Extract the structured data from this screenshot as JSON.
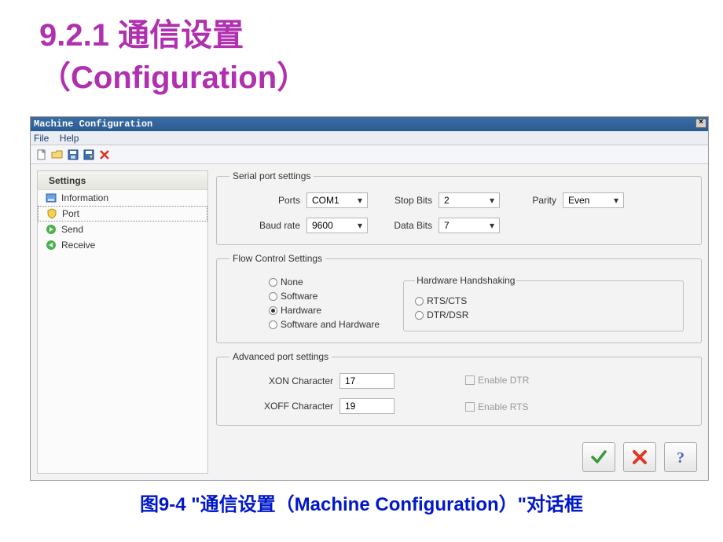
{
  "slide": {
    "title_line1": "9.2.1  通信设置",
    "title_line2": "（Configuration）",
    "caption": "图9-4  \"通信设置（Machine Configuration）\"对话框"
  },
  "window": {
    "title": "Machine Configuration",
    "menu": {
      "file": "File",
      "help": "Help"
    }
  },
  "sidebar": {
    "header": "Settings",
    "items": [
      {
        "label": "Information",
        "icon": "disk"
      },
      {
        "label": "Port",
        "icon": "shield",
        "selected": true
      },
      {
        "label": "Send",
        "icon": "arrow-green"
      },
      {
        "label": "Receive",
        "icon": "arrow-green"
      }
    ]
  },
  "serial": {
    "legend": "Serial port settings",
    "ports_label": "Ports",
    "ports_value": "COM1",
    "stopbits_label": "Stop Bits",
    "stopbits_value": "2",
    "parity_label": "Parity",
    "parity_value": "Even",
    "baud_label": "Baud rate",
    "baud_value": "9600",
    "databits_label": "Data Bits",
    "databits_value": "7"
  },
  "flow": {
    "legend": "Flow Control Settings",
    "options": [
      {
        "label": "None",
        "selected": false
      },
      {
        "label": "Software",
        "selected": false
      },
      {
        "label": "Hardware",
        "selected": true
      },
      {
        "label": "Software and Hardware",
        "selected": false
      }
    ],
    "hw": {
      "legend": "Hardware Handshaking",
      "options": [
        {
          "label": "RTS/CTS",
          "selected": false
        },
        {
          "label": "DTR/DSR",
          "selected": false
        }
      ]
    }
  },
  "advanced": {
    "legend": "Advanced port settings",
    "xon_label": "XON Character",
    "xon_value": "17",
    "xoff_label": "XOFF Character",
    "xoff_value": "19",
    "enable_dtr": "Enable DTR",
    "enable_rts": "Enable RTS"
  }
}
